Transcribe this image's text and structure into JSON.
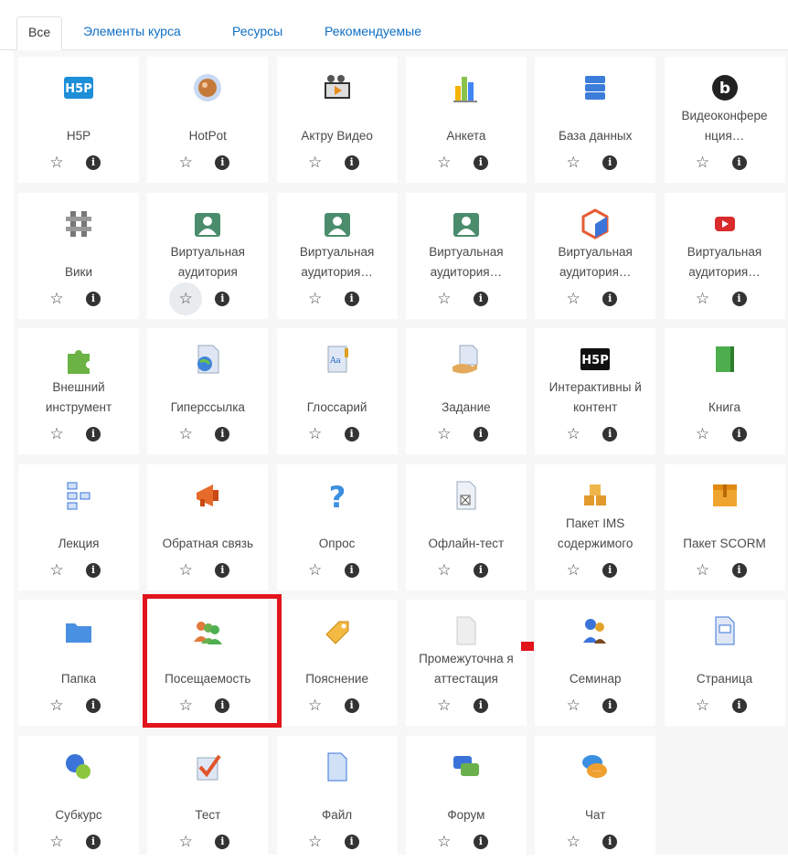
{
  "tabs": [
    {
      "label": "Все",
      "active": true
    },
    {
      "label": "Элементы курса",
      "active": false
    },
    {
      "label": "Ресурсы",
      "active": false
    },
    {
      "label": "Рекомендуемые",
      "active": false
    }
  ],
  "info_glyph": "i",
  "star_glyph": "☆",
  "highlighted_item": "Посещаемость",
  "items": [
    {
      "name": "H5P",
      "icon": "h5p-icon"
    },
    {
      "name": "HotPot",
      "icon": "hotpot-icon"
    },
    {
      "name": "Актру Видео",
      "icon": "video-film-icon"
    },
    {
      "name": "Анкета",
      "icon": "bar-chart-icon"
    },
    {
      "name": "База данных",
      "icon": "database-icon"
    },
    {
      "name": "Видеоконфере нция…",
      "icon": "bigbluebutton-icon"
    },
    {
      "name": "Вики",
      "icon": "wiki-icon"
    },
    {
      "name": "Виртуальная аудитория",
      "icon": "virtual-classroom-icon"
    },
    {
      "name": "Виртуальная аудитория…",
      "icon": "virtual-classroom-icon"
    },
    {
      "name": "Виртуальная аудитория…",
      "icon": "virtual-classroom-icon"
    },
    {
      "name": "Виртуальная аудитория…",
      "icon": "hexagon-cube-icon"
    },
    {
      "name": "Виртуальная аудитория…",
      "icon": "youtube-play-icon"
    },
    {
      "name": "Внешний инструмент",
      "icon": "puzzle-icon"
    },
    {
      "name": "Гиперссылка",
      "icon": "url-globe-icon"
    },
    {
      "name": "Глоссарий",
      "icon": "glossary-book-icon"
    },
    {
      "name": "Задание",
      "icon": "assignment-hand-icon"
    },
    {
      "name": "Интерактивны й контент",
      "icon": "h5p-dark-icon"
    },
    {
      "name": "Книга",
      "icon": "book-icon"
    },
    {
      "name": "Лекция",
      "icon": "lesson-flow-icon"
    },
    {
      "name": "Обратная связь",
      "icon": "megaphone-icon"
    },
    {
      "name": "Опрос",
      "icon": "question-icon"
    },
    {
      "name": "Офлайн-тест",
      "icon": "offline-test-icon"
    },
    {
      "name": "Пакет IMS содержимого",
      "icon": "ims-package-icon"
    },
    {
      "name": "Пакет SCORM",
      "icon": "scorm-package-icon"
    },
    {
      "name": "Папка",
      "icon": "folder-icon"
    },
    {
      "name": "Посещаемость",
      "icon": "attendance-people-icon"
    },
    {
      "name": "Пояснение",
      "icon": "label-tag-icon"
    },
    {
      "name": "Промежуточна я аттестация",
      "icon": "attestation-doc-icon"
    },
    {
      "name": "Семинар",
      "icon": "workshop-icon"
    },
    {
      "name": "Страница",
      "icon": "page-icon"
    },
    {
      "name": "Субкурс",
      "icon": "subcourse-icon"
    },
    {
      "name": "Тест",
      "icon": "quiz-check-icon"
    },
    {
      "name": "Файл",
      "icon": "file-icon"
    },
    {
      "name": "Форум",
      "icon": "forum-icon"
    },
    {
      "name": "Чат",
      "icon": "chat-icon"
    }
  ]
}
